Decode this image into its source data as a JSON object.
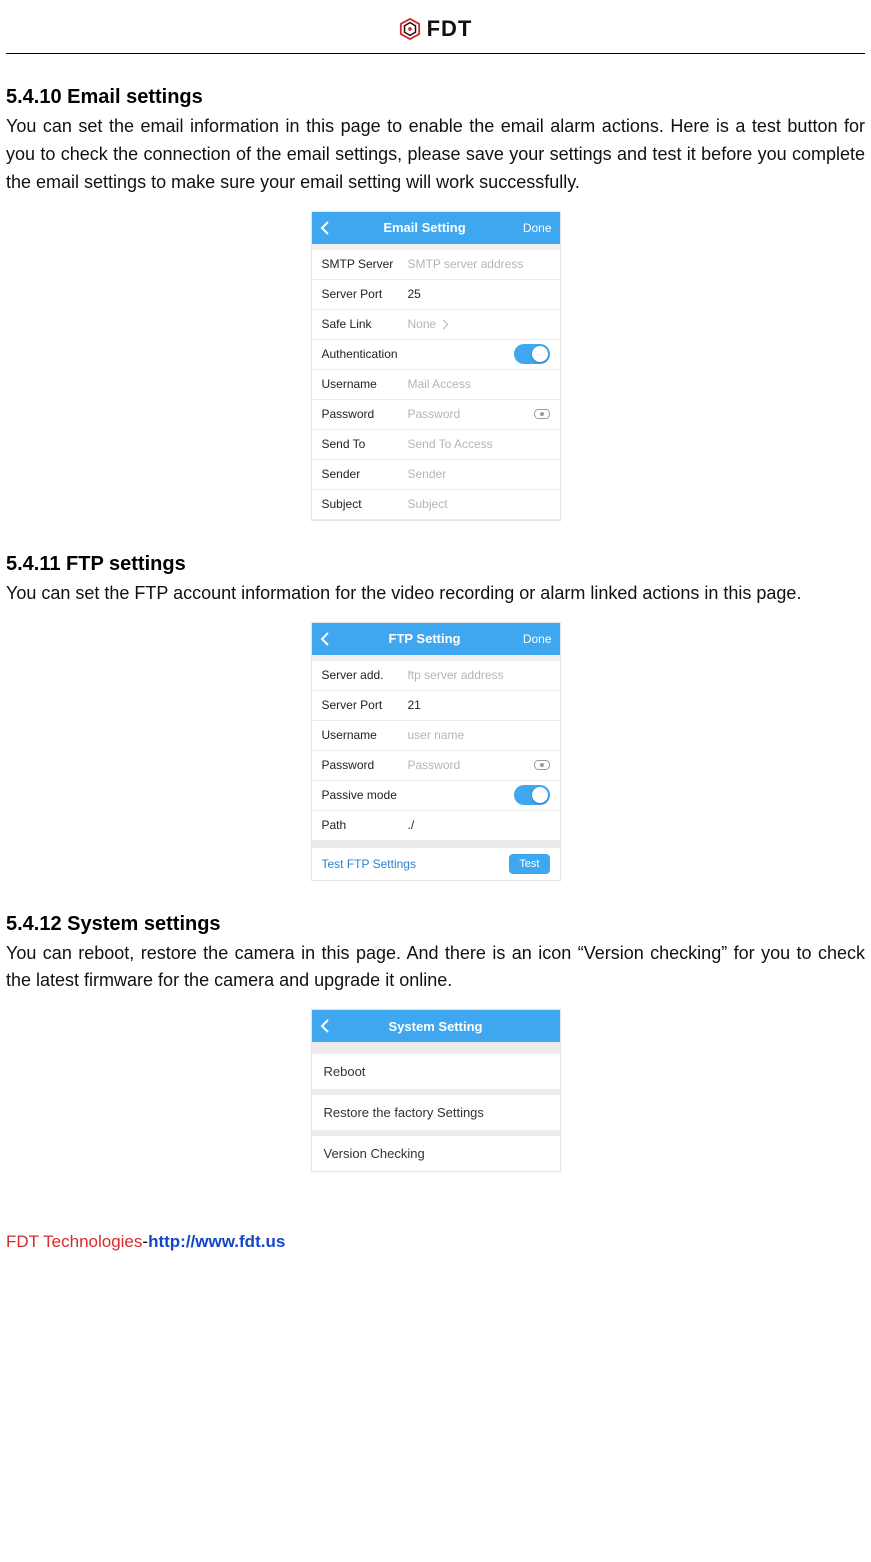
{
  "header": {
    "brand": "FDT"
  },
  "sections": {
    "email": {
      "heading": "5.4.10 Email settings",
      "body": "You can set the email information in this page to enable the email alarm actions. Here is a test button for you to check the connection of the email settings, please save your settings and test it before you complete the email settings to make sure your email setting will work successfully."
    },
    "ftp": {
      "heading": "5.4.11 FTP settings",
      "body": "You can set the FTP account information for the video recording or alarm linked actions in this page."
    },
    "system": {
      "heading": "5.4.12 System settings",
      "body": "You can reboot, restore the camera in this page. And there is an icon “Version checking” for you to check the latest firmware for the camera and upgrade it online."
    }
  },
  "email_screen": {
    "title": "Email Setting",
    "done": "Done",
    "rows": {
      "smtp_label": "SMTP Server",
      "smtp_placeholder": "SMTP server address",
      "port_label": "Server Port",
      "port_value": "25",
      "safelink_label": "Safe Link",
      "safelink_value": "None",
      "auth_label": "Authentication",
      "user_label": "Username",
      "user_placeholder": "Mail Access",
      "pass_label": "Password",
      "pass_placeholder": "Password",
      "sendto_label": "Send To",
      "sendto_placeholder": "Send To Access",
      "sender_label": "Sender",
      "sender_placeholder": "Sender",
      "subject_label": "Subject",
      "subject_placeholder": "Subject"
    }
  },
  "ftp_screen": {
    "title": "FTP Setting",
    "done": "Done",
    "rows": {
      "server_label": "Server add.",
      "server_placeholder": "ftp server address",
      "port_label": "Server Port",
      "port_value": "21",
      "user_label": "Username",
      "user_placeholder": "user name",
      "pass_label": "Password",
      "pass_placeholder": "Password",
      "passive_label": "Passive mode",
      "path_label": "Path",
      "path_value": "./"
    },
    "test_label": "Test FTP Settings",
    "test_button": "Test"
  },
  "system_screen": {
    "title": "System Setting",
    "rows": {
      "reboot": "Reboot",
      "restore": "Restore the factory Settings",
      "version": "Version Checking"
    }
  },
  "footer": {
    "company": "FDT Technologies",
    "dash": "-",
    "url": "http://www.fdt.us"
  }
}
